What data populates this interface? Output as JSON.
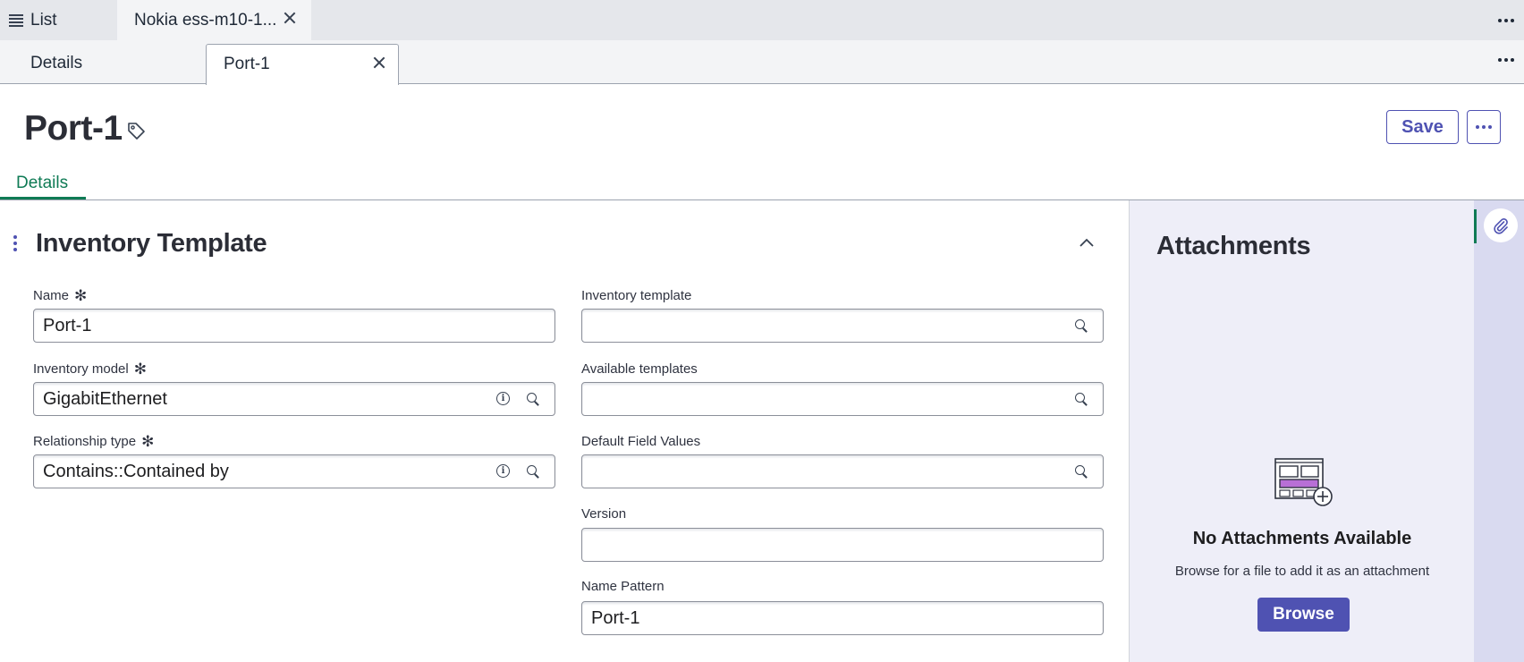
{
  "top_tabs": {
    "list_label": "List",
    "record_label": "Nokia ess-m10-1...",
    "more_icon": "more-horizontal-icon"
  },
  "sub_tabs": {
    "details_label": "Details",
    "port_label": "Port-1"
  },
  "header": {
    "title": "Port-1",
    "tag_icon": "tag-icon",
    "save_label": "Save"
  },
  "form_tabs": {
    "details_label": "Details"
  },
  "section": {
    "title": "Inventory Template"
  },
  "fields": {
    "name": {
      "label": "Name",
      "value": "Port-1",
      "required": "✻"
    },
    "inventory_model": {
      "label": "Inventory model",
      "value": "GigabitEthernet",
      "required": "✻"
    },
    "relationship_type": {
      "label": "Relationship type",
      "value": "Contains::Contained by",
      "required": "✻"
    },
    "inventory_template": {
      "label": "Inventory template",
      "value": ""
    },
    "available_templates": {
      "label": "Available templates",
      "value": ""
    },
    "default_field_values": {
      "label": "Default Field Values",
      "value": ""
    },
    "version": {
      "label": "Version",
      "value": ""
    },
    "name_pattern": {
      "label": "Name Pattern",
      "value": "Port-1"
    }
  },
  "attachments": {
    "title": "Attachments",
    "empty_title": "No Attachments Available",
    "hint": "Browse for a file to add it as an attachment",
    "browse_label": "Browse"
  },
  "colors": {
    "accent": "#4f52b2",
    "active_tab": "#0f7b55",
    "panel_bg": "#eeeef8",
    "rail_bg": "#d9daf0"
  }
}
